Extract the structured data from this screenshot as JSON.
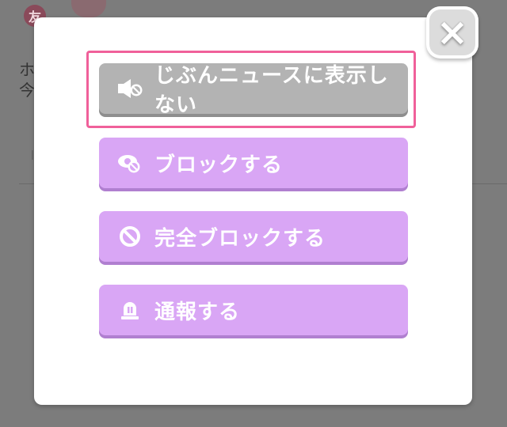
{
  "background": {
    "badge_char": "友",
    "line1_char": "ホ",
    "line2_char": "今"
  },
  "modal": {
    "close_label": "×",
    "actions": [
      {
        "label": "じぶんニュースに表示しない",
        "icon": "mute-speaker-icon",
        "style": "gray",
        "highlighted": true
      },
      {
        "label": "ブロックする",
        "icon": "block-eye-icon",
        "style": "purple"
      },
      {
        "label": "完全ブロックする",
        "icon": "prohibited-icon",
        "style": "purple"
      },
      {
        "label": "通報する",
        "icon": "alert-siren-icon",
        "style": "purple"
      }
    ]
  },
  "colors": {
    "highlight": "#f0609a",
    "gray_button": "#b3b3b3",
    "purple_button": "#d9a6f5"
  }
}
